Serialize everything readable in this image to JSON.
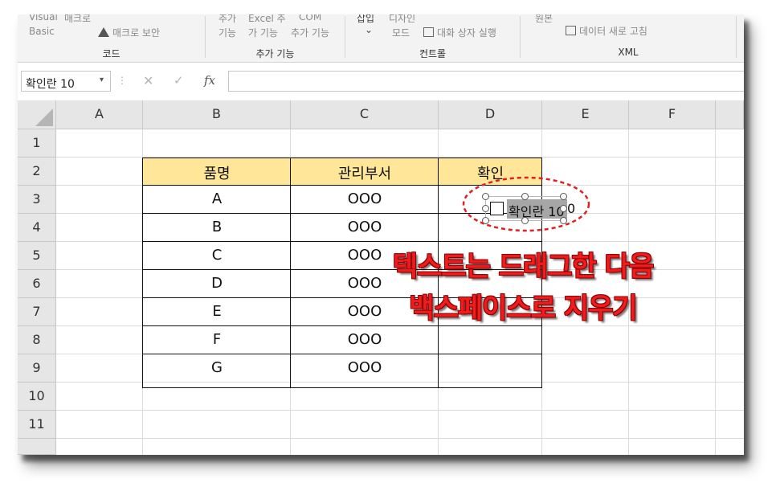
{
  "ribbon": {
    "vb_line1": "Visual",
    "vb_line2": "Basic",
    "macro_label": "매크로",
    "macro_security": "매크로 보안",
    "addin_line1": "추가",
    "addin_line2": "기능",
    "excel_addin_line1": "Excel 추",
    "excel_addin_line2": "가 기능",
    "com_addin_line1": "COM",
    "com_addin_line2": "추가 기능",
    "insert_line1": "삽입",
    "insert_arrow": "⌄",
    "design_line1": "디자인",
    "design_line2": "모드",
    "run_dialog": "대화 상자 실행",
    "source_label": "원본",
    "refresh_data": "데이터 새로 고침",
    "group_code": "코드",
    "group_addins": "추가 기능",
    "group_controls": "컨트롤",
    "group_xml": "XML"
  },
  "formula_bar": {
    "name_box": "확인란 10",
    "name_arrow": "▾",
    "dots": "⋮",
    "cancel": "✕",
    "enter": "✓",
    "fx": "fx",
    "value": ""
  },
  "grid": {
    "columns": [
      "A",
      "B",
      "C",
      "D",
      "E",
      "F"
    ],
    "rows": [
      "1",
      "2",
      "3",
      "4",
      "5",
      "6",
      "7",
      "8",
      "9",
      "10",
      "11"
    ]
  },
  "table": {
    "headers": [
      "품명",
      "관리부서",
      "확인"
    ],
    "header_fill": "#ffe699",
    "items": [
      {
        "name": "A",
        "dept": "OOO"
      },
      {
        "name": "B",
        "dept": "OOO"
      },
      {
        "name": "C",
        "dept": "OOO"
      },
      {
        "name": "D",
        "dept": "OOO"
      },
      {
        "name": "E",
        "dept": "OOO"
      },
      {
        "name": "F",
        "dept": "OOO"
      },
      {
        "name": "G",
        "dept": "OOO"
      }
    ]
  },
  "checkbox": {
    "label": "확인란 10",
    "overflow_text": "0"
  },
  "callout": {
    "line1": "텍스트는 드래그한 다음",
    "line2": "백스페이스로 지우기",
    "color": "#ee1c1c"
  }
}
